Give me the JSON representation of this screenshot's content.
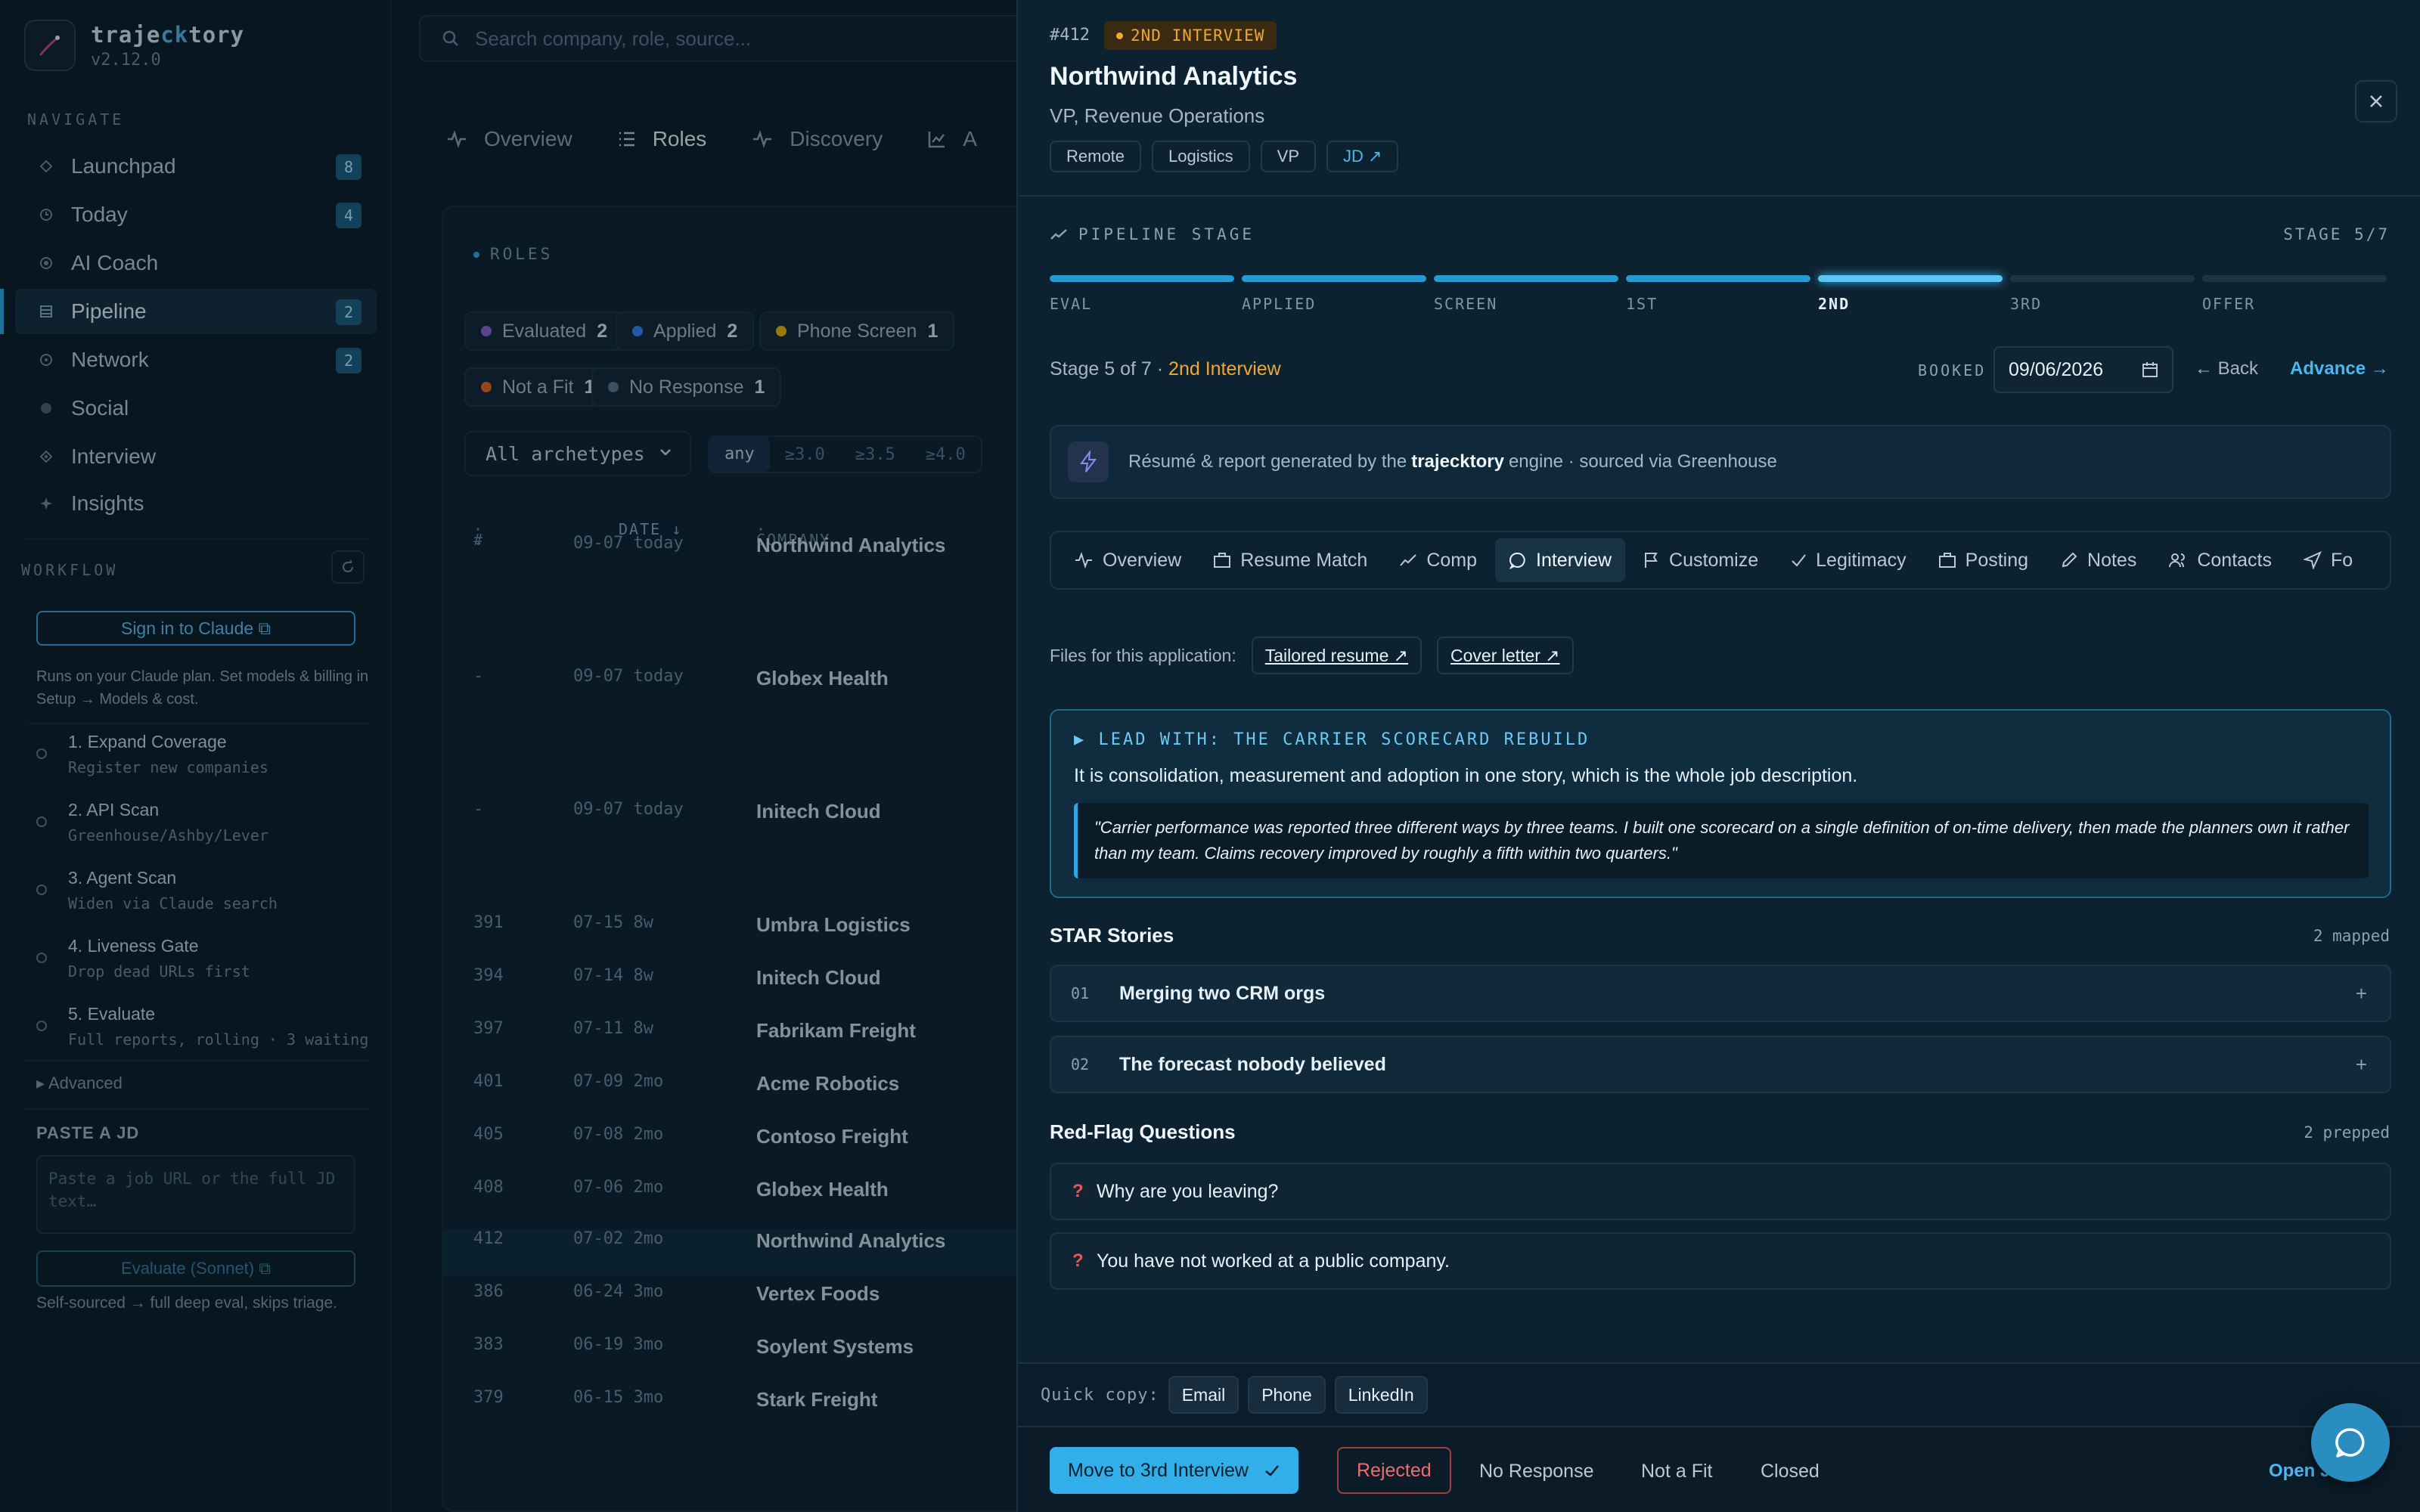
{
  "brand": {
    "name_pre": "traje",
    "name_ck": "ck",
    "name_post": "tory",
    "version": "v2.12.0"
  },
  "nav": {
    "section": "NAVIGATE",
    "items": [
      {
        "label": "Launchpad",
        "badge": "8"
      },
      {
        "label": "Today",
        "badge": "4"
      },
      {
        "label": "AI Coach",
        "badge": ""
      },
      {
        "label": "Pipeline",
        "badge": "2"
      },
      {
        "label": "Network",
        "badge": "2"
      },
      {
        "label": "Social",
        "badge": ""
      },
      {
        "label": "Interview",
        "badge": ""
      },
      {
        "label": "Insights",
        "badge": ""
      }
    ]
  },
  "workflow": {
    "section": "WORKFLOW",
    "signin": "Sign in to Claude",
    "note": "Runs on your Claude plan. Set models & billing in Setup → Models & cost.",
    "steps": [
      {
        "title": "1. Expand Coverage",
        "sub": "Register new companies"
      },
      {
        "title": "2. API Scan",
        "sub": "Greenhouse/Ashby/Lever"
      },
      {
        "title": "3. Agent Scan",
        "sub": "Widen via Claude search"
      },
      {
        "title": "4. Liveness Gate",
        "sub": "Drop dead URLs first"
      },
      {
        "title": "5. Evaluate",
        "sub": "Full reports, rolling · 3 waiting"
      }
    ],
    "advanced": "Advanced",
    "paste_label": "PASTE A JD",
    "paste_placeholder": "Paste a job URL or the full JD text…",
    "evaluate_btn": "Evaluate (Sonnet)",
    "self_note": "Self-sourced → full deep eval, skips triage."
  },
  "main": {
    "search_placeholder": "Search company, role, source...",
    "tabs": [
      "Overview",
      "Roles",
      "Discovery",
      "A"
    ],
    "roles_label": "ROLES",
    "chips": [
      {
        "label": "Evaluated",
        "count": "2",
        "color": "#8a63d2"
      },
      {
        "label": "Applied",
        "count": "2",
        "color": "#3b82f6"
      },
      {
        "label": "Phone Screen",
        "count": "1",
        "color": "#eab308"
      },
      {
        "label": "Not a Fit",
        "count": "1",
        "color": "#e0661f"
      },
      {
        "label": "No Response",
        "count": "1",
        "color": "#5d7587"
      }
    ],
    "archetype": "All archetypes",
    "ratings": [
      "any",
      "≥3.0",
      "≥3.5",
      "≥4.0"
    ],
    "columns": [
      "#",
      "DATE ↓",
      "COMPANY"
    ],
    "rows": [
      {
        "id": "-",
        "date": "09-07 today",
        "company": "Northwind Analytics"
      },
      {
        "id": "-",
        "date": "09-07 today",
        "company": "Globex Health"
      },
      {
        "id": "-",
        "date": "09-07 today",
        "company": "Initech Cloud"
      },
      {
        "id": "391",
        "date": "07-15 8w",
        "company": "Umbra Logistics"
      },
      {
        "id": "394",
        "date": "07-14 8w",
        "company": "Initech Cloud"
      },
      {
        "id": "397",
        "date": "07-11 8w",
        "company": "Fabrikam Freight"
      },
      {
        "id": "401",
        "date": "07-09 2mo",
        "company": "Acme Robotics"
      },
      {
        "id": "405",
        "date": "07-08 2mo",
        "company": "Contoso Freight"
      },
      {
        "id": "408",
        "date": "07-06 2mo",
        "company": "Globex Health"
      },
      {
        "id": "412",
        "date": "07-02 2mo",
        "company": "Northwind Analytics"
      },
      {
        "id": "386",
        "date": "06-24 3mo",
        "company": "Vertex Foods"
      },
      {
        "id": "383",
        "date": "06-19 3mo",
        "company": "Soylent Systems"
      },
      {
        "id": "379",
        "date": "06-15 3mo",
        "company": "Stark Freight"
      }
    ]
  },
  "panel": {
    "id": "#412",
    "stage_pill": "2ND INTERVIEW",
    "company": "Northwind Analytics",
    "role": "VP, Revenue Operations",
    "tags": [
      "Remote",
      "Logistics",
      "VP",
      "JD ↗"
    ],
    "pipeline_label": "PIPELINE STAGE",
    "stage_count": "STAGE 5/7",
    "stages": [
      "EVAL",
      "APPLIED",
      "SCREEN",
      "1ST",
      "2ND",
      "3RD",
      "OFFER"
    ],
    "stage_line_pre": "Stage 5 of 7 · ",
    "stage_line_name": "2nd Interview",
    "booked_label": "BOOKED",
    "booked_date": "09/06/2026",
    "back": "← Back",
    "advance": "Advance →",
    "engine_pre": "Résumé & report generated by the",
    "engine_brand": "trajecktory",
    "engine_post": "engine · sourced via Greenhouse",
    "tabs": [
      "Overview",
      "Resume Match",
      "Comp",
      "Interview",
      "Customize",
      "Legitimacy",
      "Posting",
      "Notes",
      "Contacts",
      "Fo"
    ],
    "files_label": "Files for this application:",
    "files": [
      "Tailored resume ↗",
      "Cover letter ↗"
    ],
    "lead_title": "▶ LEAD WITH: THE CARRIER SCORECARD REBUILD",
    "lead_body": "It is consolidation, measurement and adoption in one story, which is the whole job description.",
    "lead_quote": "\"Carrier performance was reported three different ways by three teams. I built one scorecard on a single definition of on-time delivery, then made the planners own it rather than my team. Claims recovery improved by roughly a fifth within two quarters.\"",
    "star_title": "STAR Stories",
    "star_count": "2 mapped",
    "stories": [
      {
        "num": "01",
        "title": "Merging two CRM orgs"
      },
      {
        "num": "02",
        "title": "The forecast nobody believed"
      }
    ],
    "flags_title": "Red-Flag Questions",
    "flags_count": "2 prepped",
    "flags": [
      "Why are you leaving?",
      "You have not worked at a public company."
    ],
    "quick_label": "Quick copy:",
    "quick": [
      "Email",
      "Phone",
      "LinkedIn"
    ],
    "move_btn": "Move to 3rd Interview",
    "rejected": "Rejected",
    "outcomes": [
      "No Response",
      "Not a Fit",
      "Closed"
    ],
    "open_link": "Open J"
  }
}
